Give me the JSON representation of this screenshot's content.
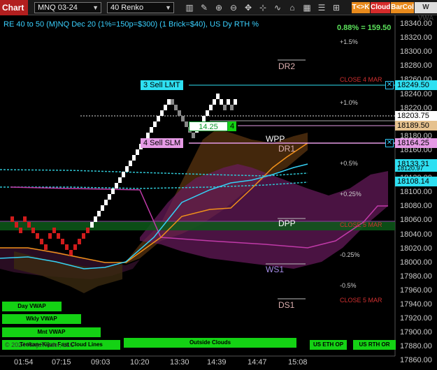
{
  "toolbar": {
    "chart_tab": "Chart",
    "instrument": "MNQ 03-24",
    "bar_type": "40 Renko",
    "tkk": "T<>K",
    "cloud": "Cloud",
    "barcol": "BarCol",
    "vwap": "W VWA"
  },
  "header": {
    "title": "RE 40 to 50 (M)NQ Dec 20 (1%=150p=$300) (1 Brick=$40), US Dy RTH %",
    "pct_change": "0.88% = 159.50"
  },
  "price_axis": {
    "labels": [
      "18340.00",
      "18320.00",
      "18300.00",
      "18280.00",
      "18260.00",
      "18240.00",
      "18220.00",
      "18200.00",
      "18180.00",
      "18160.00",
      "18140.00",
      "18120.00",
      "18100.00",
      "18080.00",
      "18060.00",
      "18040.00",
      "18020.00",
      "18000.00",
      "17980.00",
      "17960.00",
      "17940.00",
      "17920.00",
      "17900.00",
      "17880.00",
      "17860.00"
    ],
    "current_price": "18203.75",
    "box_18249": "18249.50",
    "box_18189": "18189.50",
    "box_18164": "18164.25",
    "box_18133": "18133.31",
    "box_18120": "18120.97",
    "box_18108": "18108.14"
  },
  "time_axis": [
    "01:54",
    "07:15",
    "09:03",
    "10:20",
    "13:30",
    "14:39",
    "14:47",
    "15:08"
  ],
  "levels": {
    "pct_1_5": "+1.5%",
    "pct_1_0": "+1.0%",
    "pct_0_5": "+0.5%",
    "pct_0_25": "+0.25%",
    "pct_m0_25": "-0.25%",
    "pct_m0_5": "-0.5%",
    "close_4_mar": "CLOSE 4 MAR",
    "close_5_mar_a": "CLOSE 5 MAR",
    "close_5_mar_b": "CLOSE 5 MAR"
  },
  "pivots": {
    "dr2": "DR2",
    "dr1": "DR1",
    "wpp": "WPP",
    "dpp": "DPP",
    "ws1": "WS1",
    "ds1": "DS1"
  },
  "orders": {
    "sell_lmt": "3 Sell LMT",
    "sell_slm": "4 Sell SLM",
    "qty_price": "14.25",
    "qty": "4"
  },
  "buttons": {
    "day_vwap": "Day VWAP",
    "wkly_vwap": "Wkly VWAP",
    "mnt_vwap": "Mnt VWAP",
    "tenkan": "Tenkan+Kijun Fast Cloud Lines",
    "outside_clouds": "Outside Clouds",
    "us_eth_op": "US ETH OP",
    "us_rth_or": "US RTH OR"
  },
  "watermark": "© 2024 NinjaTrader, LLC",
  "colors": {
    "up_brick": "#ffffff",
    "down_brick": "#d01c1c",
    "gray_brick": "#888888",
    "sell_lmt": "#2ee0f2",
    "sell_slm": "#e59ae5",
    "green": "#14d214",
    "chart_tab": "#b21f1f"
  }
}
